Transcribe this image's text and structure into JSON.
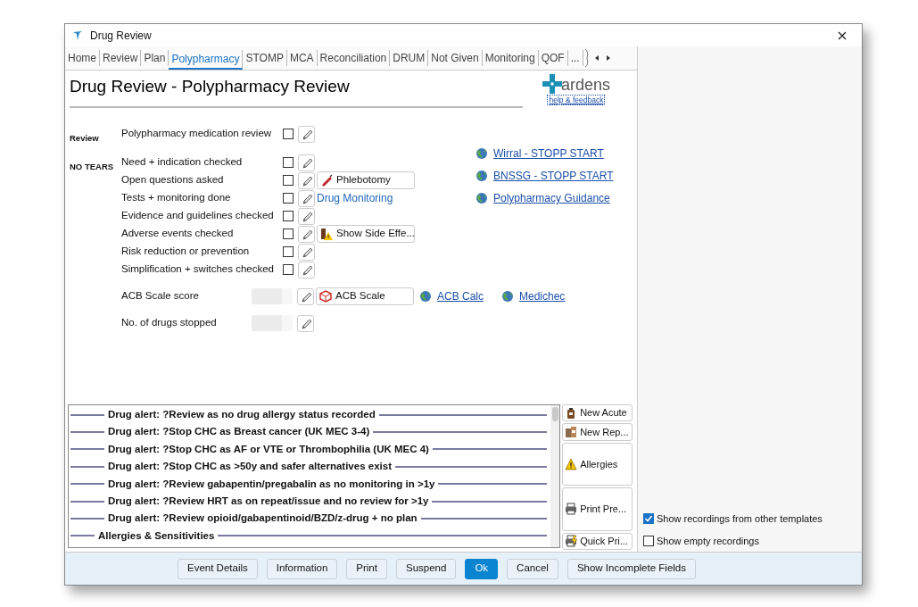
{
  "window": {
    "title": "Drug Review"
  },
  "tabs": [
    {
      "label": "Home",
      "selected": false
    },
    {
      "label": "Review",
      "selected": false
    },
    {
      "label": "Plan",
      "selected": false
    },
    {
      "label": "Polypharmacy",
      "selected": true
    },
    {
      "label": "STOMP",
      "selected": false
    },
    {
      "label": "MCA",
      "selected": false
    },
    {
      "label": "Reconciliation",
      "selected": false
    },
    {
      "label": "DRUM",
      "selected": false
    },
    {
      "label": "Not Given",
      "selected": false
    },
    {
      "label": "Monitoring",
      "selected": false
    },
    {
      "label": "QOF",
      "selected": false
    },
    {
      "label": "...",
      "selected": false
    }
  ],
  "header": {
    "title": "Drug Review - Polypharmacy Review",
    "logo": "ardens",
    "help_link": "help & feedback"
  },
  "sections": [
    {
      "label": "Review",
      "items": [
        {
          "kind": "check",
          "label": "Polypharmacy medication review",
          "checked": false
        }
      ]
    },
    {
      "label": "NO TEARS",
      "items": [
        {
          "kind": "check",
          "label": "Need + indication checked",
          "checked": false
        },
        {
          "kind": "check",
          "label": "Open questions asked",
          "checked": false,
          "extras": [
            {
              "kind": "button",
              "label": "Phlebotomy"
            }
          ]
        },
        {
          "kind": "check",
          "label": "Tests + monitoring done",
          "checked": false,
          "extras": [
            {
              "kind": "link",
              "label": "Drug Monitoring"
            }
          ]
        },
        {
          "kind": "check",
          "label": "Evidence and guidelines checked",
          "checked": false
        },
        {
          "kind": "check",
          "label": "Adverse events checked",
          "checked": false,
          "extras": [
            {
              "kind": "button",
              "label": "Show Side Effe..."
            }
          ]
        },
        {
          "kind": "check",
          "label": "Risk reduction or prevention",
          "checked": false
        },
        {
          "kind": "check",
          "label": "Simplification + switches checked",
          "checked": false
        }
      ]
    },
    {
      "items": [
        {
          "kind": "score",
          "label": "ACB Scale score",
          "extras": [
            {
              "kind": "button",
              "label": "ACB Scale"
            },
            {
              "kind": "web_link",
              "label": "ACB Calc"
            },
            {
              "kind": "web_link",
              "label": "Medichec"
            }
          ]
        },
        {
          "kind": "score",
          "label": "No. of drugs stopped"
        }
      ]
    }
  ],
  "links": [
    "Wirral - STOPP START",
    "BNSSG - STOPP START",
    "Polypharmacy Guidance"
  ],
  "alerts": [
    {
      "kind": "alert",
      "text": "Drug alert: ?Review as no drug allergy status recorded"
    },
    {
      "kind": "alert",
      "text": "Drug alert: ?Stop CHC as Breast cancer (UK MEC 3-4)"
    },
    {
      "kind": "alert",
      "text": "Drug alert: ?Stop CHC as AF or VTE or Thrombophilia (UK MEC 4)"
    },
    {
      "kind": "alert",
      "text": "Drug alert: ?Stop CHC as >50y and safer alternatives exist"
    },
    {
      "kind": "alert",
      "text": "Drug alert: ?Review gabapentin/pregabalin as no monitoring in >1y"
    },
    {
      "kind": "alert",
      "text": "Drug alert: ?Review HRT as on repeat/issue and no review for >1y"
    },
    {
      "kind": "alert",
      "text": "Drug alert: ?Review opioid/gabapentinoid/BZD/z-drug + no plan"
    },
    {
      "kind": "heading",
      "text": "Allergies & Sensitivities"
    }
  ],
  "side_buttons": [
    "New Acute",
    "New Rep...",
    "Allergies",
    "Print Pre...",
    "Quick Pri..."
  ],
  "options": [
    {
      "label": "Show recordings from other templates",
      "checked": true
    },
    {
      "label": "Show empty recordings",
      "checked": false
    }
  ],
  "footer_buttons": [
    {
      "label": "Event Details",
      "primary": false
    },
    {
      "label": "Information",
      "primary": false
    },
    {
      "label": "Print",
      "primary": false
    },
    {
      "label": "Suspend",
      "primary": false
    },
    {
      "label": "Ok",
      "primary": true
    },
    {
      "label": "Cancel",
      "primary": false
    },
    {
      "label": "Show Incomplete Fields",
      "primary": false
    }
  ]
}
